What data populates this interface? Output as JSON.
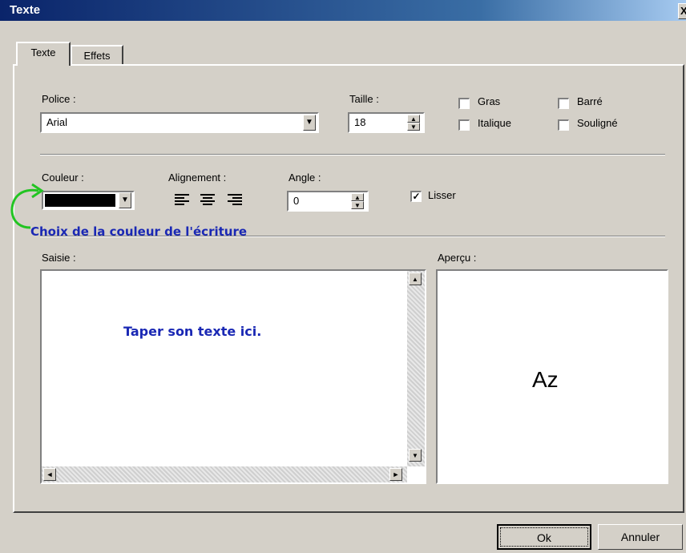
{
  "window": {
    "title": "Texte",
    "close_glyph": "X"
  },
  "tabs": [
    {
      "label": "Texte"
    },
    {
      "label": "Effets"
    }
  ],
  "font": {
    "label": "Police :",
    "value": "Arial"
  },
  "size": {
    "label": "Taille :",
    "value": "18"
  },
  "checkboxes": {
    "bold": {
      "label": "Gras",
      "checked": false
    },
    "italic": {
      "label": "Italique",
      "checked": false
    },
    "strike": {
      "label": "Barré",
      "checked": false
    },
    "underline": {
      "label": "Souligné",
      "checked": false
    },
    "smooth": {
      "label": "Lisser",
      "checked": true,
      "mark": "✓"
    }
  },
  "color": {
    "label": "Couleur :",
    "value_hex": "#000000"
  },
  "alignment": {
    "label": "Alignement :",
    "options": [
      "left",
      "center",
      "right"
    ],
    "selected": "left"
  },
  "angle": {
    "label": "Angle :",
    "value": "0"
  },
  "annotations": {
    "color_hint": "Choix de la couleur de l'écriture",
    "input_hint": "Taper son texte ici.",
    "arrow_color": "#22c422",
    "text_color": "#1a28b4"
  },
  "input": {
    "label": "Saisie :"
  },
  "preview": {
    "label": "Aperçu :",
    "sample": "Az"
  },
  "buttons": {
    "ok": "Ok",
    "cancel": "Annuler"
  },
  "icons": {
    "dropdown": "▼",
    "spin_up": "▲",
    "spin_down": "▼",
    "scroll_left": "◄",
    "scroll_right": "►"
  }
}
